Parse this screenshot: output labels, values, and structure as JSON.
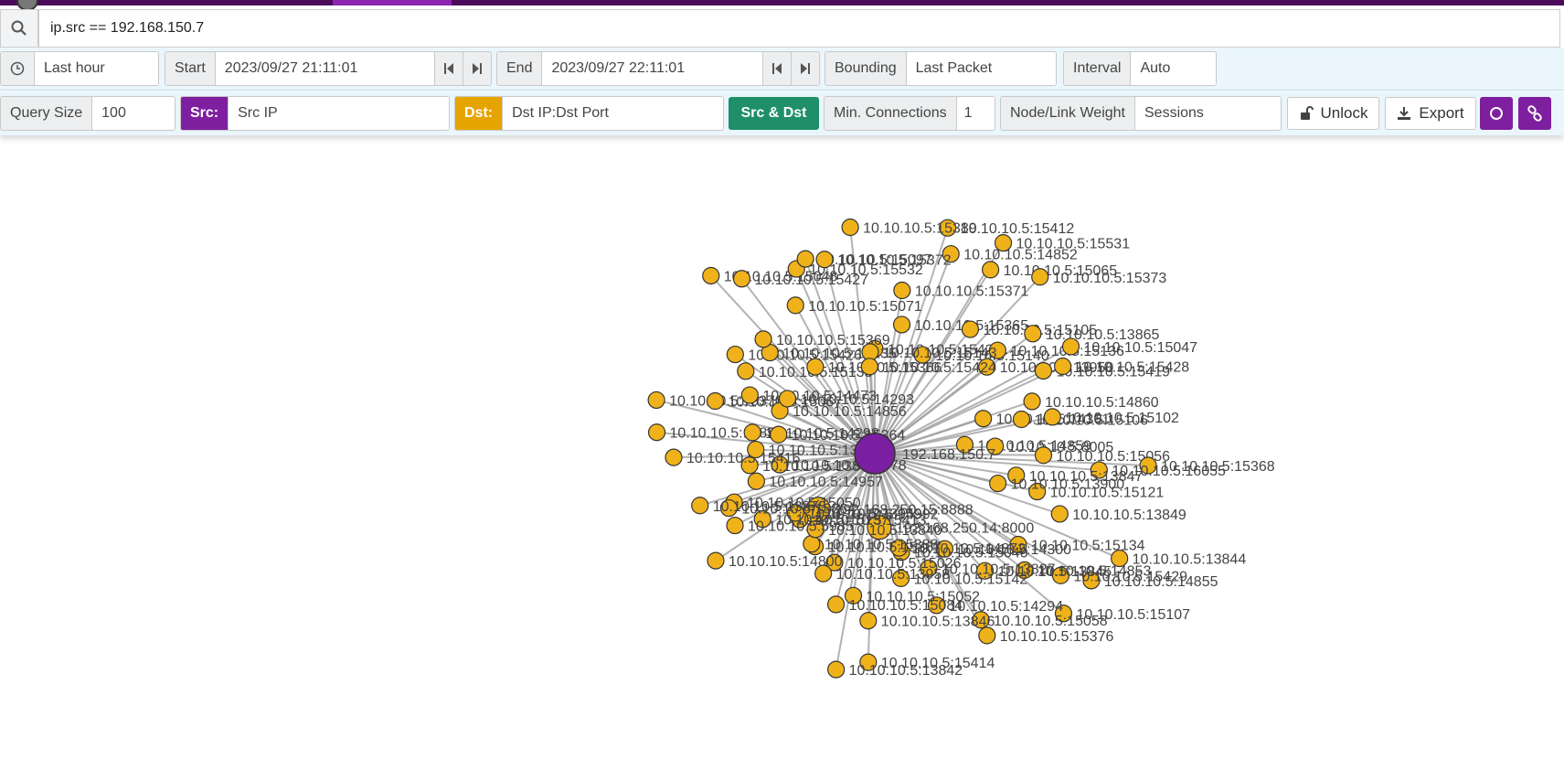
{
  "search": {
    "query": "ip.src == 192.168.150.7"
  },
  "time": {
    "range": "Last hour",
    "start_label": "Start",
    "start_value": "2023/09/27 21:11:01",
    "end_label": "End",
    "end_value": "2023/09/27 22:11:01",
    "bounding_label": "Bounding",
    "bounding_value": "Last Packet",
    "interval_label": "Interval",
    "interval_value": "Auto"
  },
  "controls": {
    "query_size_label": "Query Size",
    "query_size_value": "100",
    "src_label": "Src:",
    "src_value": "Src IP",
    "dst_label": "Dst:",
    "dst_value": "Dst IP:Dst Port",
    "src_dst_label": "Src & Dst",
    "min_conn_label": "Min. Connections",
    "min_conn_value": "1",
    "weight_label": "Node/Link Weight",
    "weight_value": "Sessions",
    "unlock_label": "Unlock",
    "export_label": "Export"
  },
  "colors": {
    "src_node": "#7b1fa2",
    "dst_node": "#f0b21a",
    "link": "#9a9a9a",
    "brand": "#7e1fa0"
  },
  "graph": {
    "center": "192.168.150.7",
    "nodes": [
      "10.10.10.5:15425",
      "10.10.10.5:15365",
      "10.10.10.5:15371",
      "10.10.10.5:15412",
      "10.10.10.5:14852",
      "10.10.10.5:15140",
      "10.10.10.5:15531",
      "10.10.10.5:15065",
      "10.10.10.5:15105",
      "10.10.10.5:15373",
      "10.10.10.5:15136",
      "10.10.10.5:13865",
      "10.10.10.5:13950",
      "10.10.10.5:15047",
      "10.10.10.5:15419",
      "10.10.10.5:15428",
      "10.10.10.5:14860",
      "10.10.10.5:14361",
      "10.10.10.5:15106",
      "10.10.10.5:15102",
      "10.10.10.5:14859",
      "10.10.10.5:8005",
      "10.10.10.5:15056",
      "10.10.10.5:15368",
      "10.10.10.5:16055",
      "10.10.10.5:13847",
      "10.10.10.5:15121",
      "10.10.10.5:13900",
      "10.10.10.5:13849",
      "10.10.10.5:13844",
      "10.10.10.5:14855",
      "10.10.10.5:15134",
      "10.10.10.5:15429",
      "10.10.10.5:14853",
      "10.10.10.5:15107",
      "10.10.10.5:13845",
      "10.10.10.5:14300",
      "10.10.10.5:15058",
      "10.10.10.5:15376",
      "10.10.10.5:13827",
      "10.10.10.5:14294",
      "10.10.10.5:15040",
      "10.10.10.5:14872",
      "10.10.10.5:15142",
      "192.168.250.14:8000",
      "10.10.10.5:15414",
      "10.10.10.5:13846",
      "10.10.10.5:15052",
      "10.10.10.5:13842",
      "10.10.10.5:15084",
      "10.10.10.5:15026",
      "10.10.10.5:13958",
      "10.10.10.5:15367",
      "10.10.10.5:15388",
      "10.10.10.5:13840",
      "192.168.250.15:8888",
      "10.10.10.5:14992",
      "10.10.10.5:15413",
      "10.10.10.5:13959",
      "10.10.10.5:14800",
      "10.10.10.5:15137",
      "10.10.10.5:5985",
      "10.10.10.5:15050",
      "10.10.10.5:13864",
      "10.10.10.5:13875",
      "10.10.10.5:14957",
      "10.10.10.5:14878",
      "10.10.10.5:13841",
      "10.10.10.5:15416",
      "10.10.10.5:13839",
      "10.10.10.5:14854",
      "10.10.10.5:14298",
      "10.10.10.5:15364",
      "10.10.10.5:15370",
      "10.10.10.5:15067",
      "10.10.10.5:14856",
      "10.10.10.5:14473",
      "10.10.10.5:14293",
      "10.10.10.5:15133",
      "10.10.10.5:15426",
      "10.10.10.5:15135",
      "10.10.10.5:15369",
      "10.10.10.5:15048",
      "10.10.10.5:15427",
      "10.10.10.5:15366",
      "10.10.10.5:15071",
      "10.10.10.5:15532",
      "10.10.10.5:15097",
      "10.10.10.5:15372",
      "10.10.10.5:15389",
      "10.10.10.5:15143",
      "10.10.10.5:15424"
    ]
  }
}
